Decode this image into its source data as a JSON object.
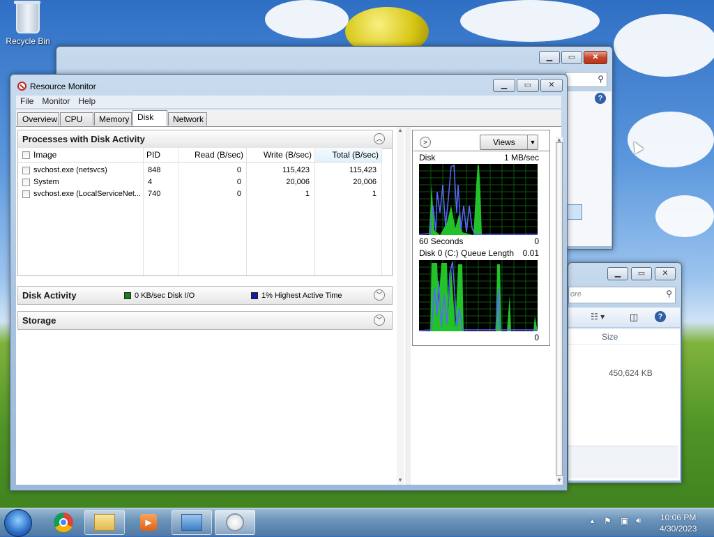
{
  "desktop": {
    "recycle_bin_label": "Recycle Bin"
  },
  "resource_monitor": {
    "title": "Resource Monitor",
    "menu": [
      "File",
      "Monitor",
      "Help"
    ],
    "tabs": [
      "Overview",
      "CPU",
      "Memory",
      "Disk",
      "Network"
    ],
    "active_tab": "Disk",
    "processes_section": {
      "title": "Processes with Disk Activity",
      "columns": [
        "Image",
        "PID",
        "Read (B/sec)",
        "Write (B/sec)",
        "Total (B/sec)"
      ],
      "sorted_column": "Total (B/sec)",
      "rows": [
        {
          "image": "svchost.exe (netsvcs)",
          "pid": "848",
          "read": "0",
          "write": "115,423",
          "total": "115,423"
        },
        {
          "image": "System",
          "pid": "4",
          "read": "0",
          "write": "20,006",
          "total": "20,006"
        },
        {
          "image": "svchost.exe (LocalServiceNet...",
          "pid": "740",
          "read": "0",
          "write": "1",
          "total": "1"
        }
      ]
    },
    "disk_activity_section": {
      "title": "Disk Activity",
      "io_legend": "0 KB/sec Disk I/O",
      "active_time_legend": "1% Highest Active Time",
      "io_color": "#1e7a1e",
      "active_color": "#1a1aa6"
    },
    "storage_section": {
      "title": "Storage"
    },
    "graphs_pane": {
      "views_label": "Views",
      "disk_graph": {
        "label": "Disk",
        "scale": "1 MB/sec",
        "time_span": "60 Seconds",
        "min": "0"
      },
      "queue_graph": {
        "label": "Disk 0 (C:) Queue Length",
        "scale": "0.01",
        "min": "0"
      }
    }
  },
  "explorer_window": {
    "search_placeholder": "ore",
    "size_header": "Size",
    "size_value": "450,624 KB"
  },
  "taskbar": {
    "time": "10:06 PM",
    "date": "4/30/2023"
  }
}
